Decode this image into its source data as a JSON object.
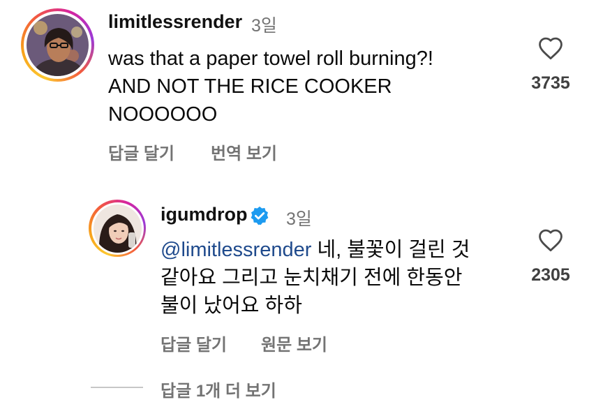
{
  "comment1": {
    "username": "limitlessrender",
    "time": "3일",
    "lines": [
      "was that a paper towel roll burning?!",
      "AND NOT THE RICE COOKER",
      "NOOOOOO"
    ],
    "likes": "3735",
    "reply_label": "답글 달기",
    "translate_label": "번역 보기"
  },
  "reply1": {
    "username": "igumdrop",
    "time": "3일",
    "mention": "@limitlessrender",
    "line1_rest": " 네, 불꽃이 걸린 것",
    "line2": "같아요 그리고 눈치채기 전에 한동안",
    "line3": "불이 났어요 하하",
    "likes": "2305",
    "reply_label": "답글 달기",
    "original_label": "원문 보기"
  },
  "more_replies": {
    "label": "답글 1개 더 보기"
  },
  "icons": {
    "heart": "heart-outline-icon",
    "verified": "verified-badge-icon"
  },
  "colors": {
    "mention": "#1f4a8c",
    "verified": "#1d9bf0",
    "muted": "#737373"
  }
}
